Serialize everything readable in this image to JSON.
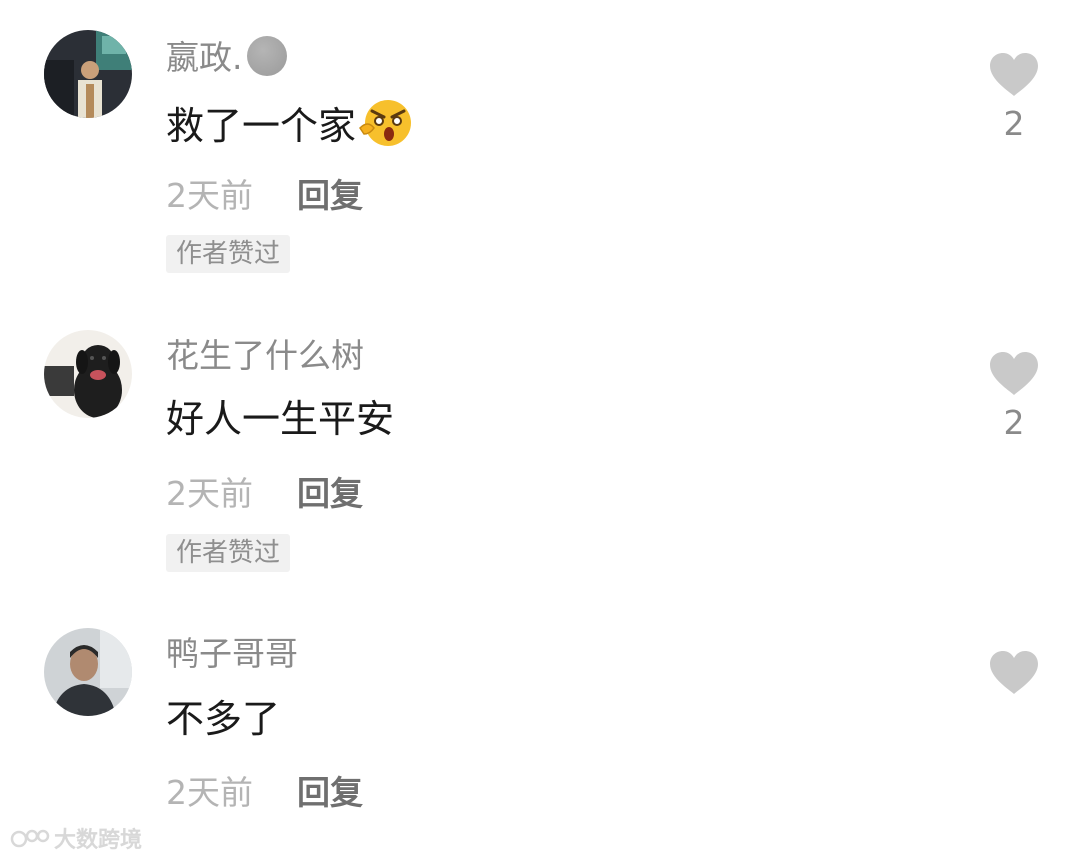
{
  "comments": [
    {
      "username": "嬴政.",
      "text": "救了一个家",
      "time": "2天前",
      "reply": "回复",
      "tag": "作者赞过",
      "likes": "2"
    },
    {
      "username": "花生了什么树",
      "text": "好人一生平安",
      "time": "2天前",
      "reply": "回复",
      "tag": "作者赞过",
      "likes": "2"
    },
    {
      "username": "鸭子哥哥",
      "text": "不多了",
      "time": "2天前",
      "reply": "回复",
      "tag": "",
      "likes": ""
    }
  ],
  "watermark": "大数跨境",
  "colors": {
    "username": "#8a8a8a",
    "text": "#1a1a1a",
    "time": "#b4b4b4",
    "reply": "#6f6f6f",
    "heart": "#c9c9c9",
    "tag_bg": "#f1f1f1"
  },
  "icons": [
    "heart-icon",
    "shocked-face-emoji",
    "vip-badge-dot"
  ]
}
